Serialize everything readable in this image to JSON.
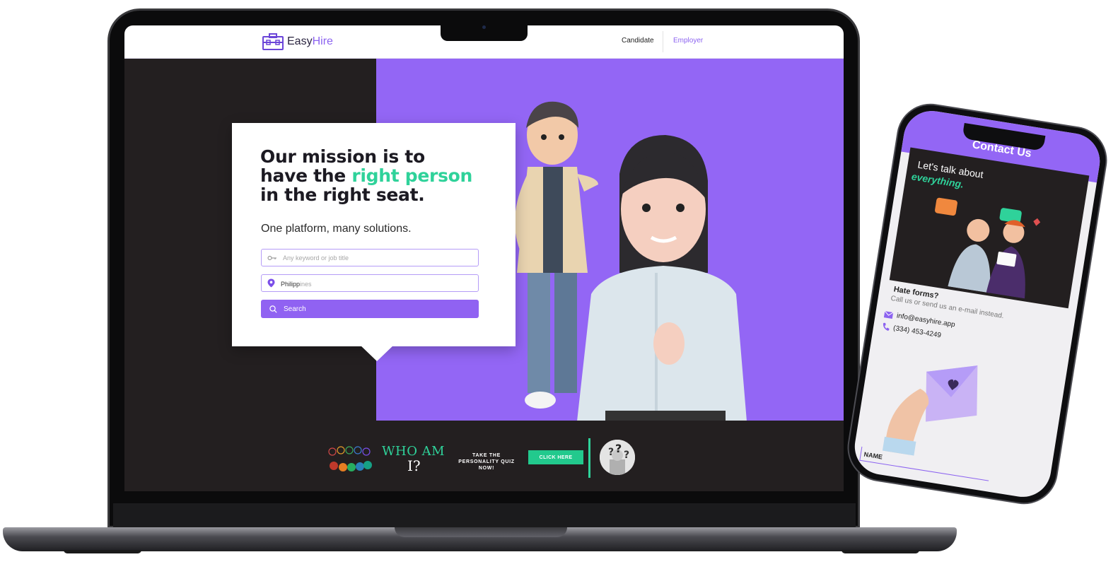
{
  "colors": {
    "purple": "#9366f5",
    "green": "#2fd29a",
    "dark": "#231f20",
    "white": "#ffffff"
  },
  "site": {
    "logo": {
      "main": "Easy",
      "accent": "Hire",
      "icon": "briefcase-icon"
    },
    "nav": {
      "candidate": "Candidate",
      "employer": "Employer"
    }
  },
  "hero": {
    "title_1": "Our mission is to",
    "title_2a": "have the ",
    "title_2b": "right person",
    "title_3": "in the right seat.",
    "subtitle": "One platform, many solutions.",
    "keyword_placeholder": "Any keyword or job title",
    "location_value": "Philipp",
    "location_placeholder": "ines",
    "search_label": "Search"
  },
  "banner": {
    "title_1": "WHO AM",
    "title_2": "I?",
    "cta_text": "TAKE THE PERSONALITY QUIZ NOW!",
    "button": "CLICK HERE"
  },
  "phone": {
    "header": "Contact Us",
    "talk_1": "Let's talk about",
    "talk_2": "everything.",
    "hate": "Hate forms?",
    "hate_sub": "Call us or send us an e-mail instead.",
    "email": "info@easyhire.app",
    "phone": "(334) 453-4249",
    "name_field": "NAME"
  }
}
